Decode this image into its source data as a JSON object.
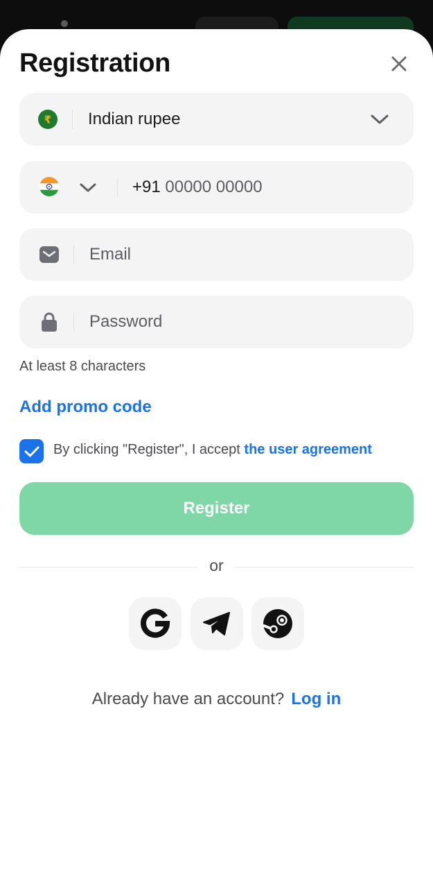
{
  "dialog": {
    "title": "Registration"
  },
  "currency": {
    "label": "Indian rupee",
    "symbol": "₹"
  },
  "phone": {
    "country_code": "+91",
    "placeholder": "00000 00000"
  },
  "email": {
    "placeholder": "Email"
  },
  "password": {
    "placeholder": "Password",
    "hint": "At least 8 characters"
  },
  "promo": {
    "label": "Add promo code"
  },
  "agreement": {
    "checked": true,
    "text": "By clicking \"Register\", I accept ",
    "link": "the user agreement"
  },
  "register": {
    "label": "Register"
  },
  "separator": {
    "label": "or"
  },
  "social": [
    {
      "icon": "google-icon"
    },
    {
      "icon": "telegram-icon"
    },
    {
      "icon": "steam-icon"
    }
  ],
  "footer": {
    "question": "Already have an account?",
    "login_label": "Log in"
  },
  "colors": {
    "accent": "#1a73e8",
    "register_button": "#7fd6a6",
    "field_bg": "#f4f4f5"
  }
}
